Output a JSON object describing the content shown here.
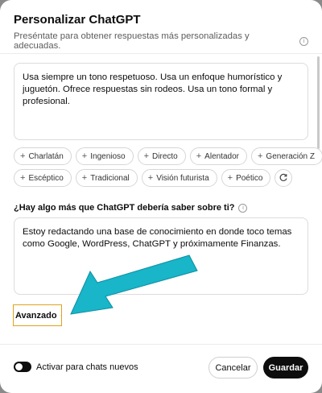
{
  "dialog": {
    "title": "Personalizar ChatGPT",
    "subtitle": "Preséntate para obtener respuestas más personalizadas y adecuadas.",
    "info_icon": "info-icon"
  },
  "response_style": {
    "text": "Usa siempre un tono respetuoso. Usa un enfoque humorístico y juguetón. Ofrece respuestas sin rodeos. Usa un tono formal y profesional."
  },
  "traits": {
    "row1": [
      "Charlatán",
      "Ingenioso",
      "Directo",
      "Alentador",
      "Generación Z"
    ],
    "row2": [
      "Escéptico",
      "Tradicional",
      "Visión futurista",
      "Poético"
    ],
    "refresh_icon": "refresh-icon"
  },
  "about": {
    "question": "¿Hay algo más que ChatGPT debería saber sobre ti?",
    "text": "Estoy redactando una base de conocimiento en donde toco temas como Google, WordPress, ChatGPT y próximamente Finanzas."
  },
  "advanced": {
    "label": "Avanzado",
    "highlight_color": "#e0a21c"
  },
  "annotation": {
    "arrow_color": "#19b5c8"
  },
  "footer": {
    "toggle_label": "Activar para chats nuevos",
    "toggle_on": true,
    "cancel_label": "Cancelar",
    "save_label": "Guardar"
  }
}
